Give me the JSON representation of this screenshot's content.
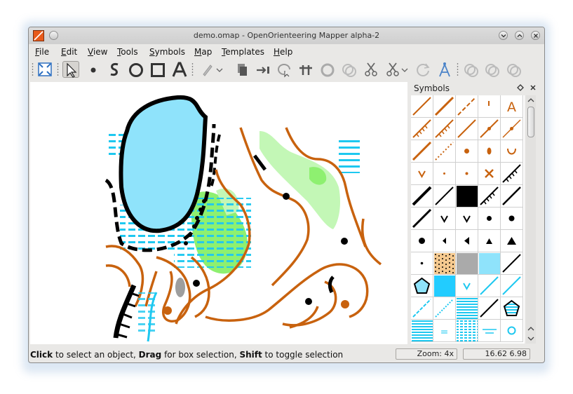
{
  "window": {
    "title": "demo.omap - OpenOrienteering Mapper alpha-2"
  },
  "menu": [
    {
      "label": "File"
    },
    {
      "label": "Edit"
    },
    {
      "label": "View"
    },
    {
      "label": "Tools"
    },
    {
      "label": "Symbols"
    },
    {
      "label": "Map"
    },
    {
      "label": "Templates"
    },
    {
      "label": "Help"
    }
  ],
  "toolbar": {
    "tools": [
      "fit-view-icon",
      "select-arrow-icon",
      "draw-point-icon",
      "draw-path-icon",
      "draw-circle-icon",
      "draw-rectangle-icon",
      "draw-text-icon",
      "edit-pen-icon",
      "duplicate-icon",
      "switch-direction-icon",
      "rotate-icon",
      "cut-tool-icon",
      "fill-border-icon",
      "cut-hole-icon",
      "union-icon",
      "scissors-icon",
      "cut-area-icon",
      "undo-rotate-icon",
      "measure-icon",
      "intersect-icon",
      "difference-icon",
      "xor-icon"
    ]
  },
  "symbols_panel": {
    "title": "Symbols",
    "text_symbol_glyph": "A",
    "text_equals_glyph": "="
  },
  "status": {
    "click": "Click",
    "t1": " to select an object, ",
    "drag": "Drag",
    "t2": " for box selection, ",
    "shift": "Shift",
    "t3": " to toggle selection",
    "zoom": "Zoom: 4x",
    "coords": "16.62 6.98"
  },
  "colors": {
    "brown": "#c8620e",
    "blue": "#1ec8f0",
    "lake": "#8fe3fb",
    "green_light": "#c3f7b6",
    "green": "#8ef070",
    "black": "#000000"
  }
}
